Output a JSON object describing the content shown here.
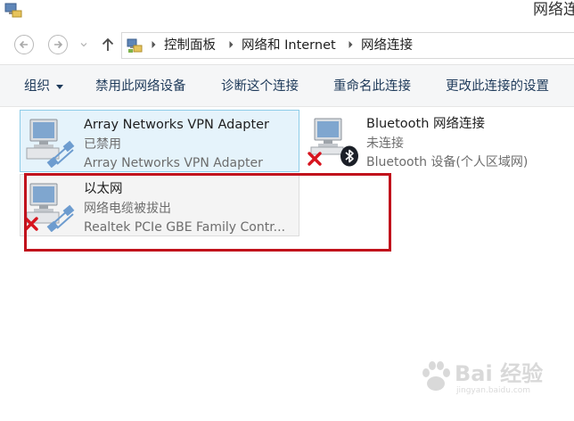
{
  "window": {
    "title": "网络连"
  },
  "address_bar": {
    "breadcrumb": [
      "控制面板",
      "网络和 Internet",
      "网络连接"
    ]
  },
  "command_bar": {
    "organize": "组织",
    "disable": "禁用此网络设备",
    "diagnose": "诊断这个连接",
    "rename": "重命名此连接",
    "change_settings": "更改此连接的设置"
  },
  "connections": [
    {
      "name": "Array Networks VPN Adapter",
      "status": "已禁用",
      "device": "Array Networks VPN Adapter",
      "icon": "network-adapter-icon",
      "state": "selected"
    },
    {
      "name": "Bluetooth 网络连接",
      "status": "未连接",
      "device": "Bluetooth 设备(个人区域网)",
      "icon": "network-adapter-icon",
      "badge": "bluetooth-icon",
      "error": true
    },
    {
      "name": "以太网",
      "status": "网络电缆被拔出",
      "device": "Realtek PCIe GBE Family Contr...",
      "icon": "network-adapter-icon",
      "error": true,
      "state": "highlighted"
    }
  ],
  "watermark": {
    "text": "Bai 经验",
    "url": "jingyan.baidu.com"
  },
  "colors": {
    "accent_selected_bg": "#e5f3fb",
    "accent_selected_border": "#8dcce8",
    "annotation_red": "#c1121c",
    "error_red": "#d7141e"
  }
}
